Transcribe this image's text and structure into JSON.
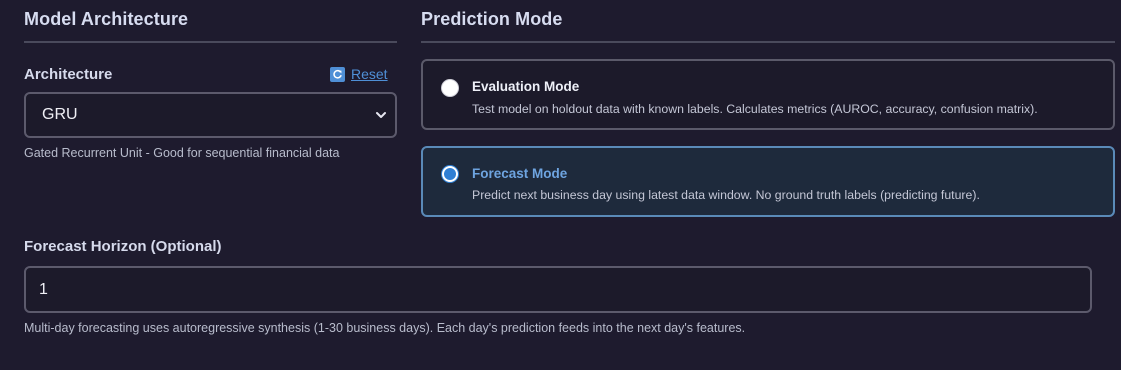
{
  "model_architecture": {
    "title": "Model Architecture",
    "architecture_label": "Architecture",
    "reset_label": "Reset",
    "reset_icon": "refresh-icon",
    "selected_value": "GRU",
    "help_text": "Gated Recurrent Unit - Good for sequential financial data"
  },
  "prediction_mode": {
    "title": "Prediction Mode",
    "options": [
      {
        "label": "Evaluation Mode",
        "description": "Test model on holdout data with known labels. Calculates metrics (AUROC, accuracy, confusion matrix).",
        "selected": false
      },
      {
        "label": "Forecast Mode",
        "description": "Predict next business day using latest data window. No ground truth labels (predicting future).",
        "selected": true
      }
    ]
  },
  "forecast_horizon": {
    "label": "Forecast Horizon (Optional)",
    "value": "1",
    "help_text": "Multi-day forecasting uses autoregressive synthesis (1-30 business days). Each day's prediction feeds into the next day's features."
  },
  "colors": {
    "background": "#1e1b2e",
    "accent": "#2f7fd4",
    "link": "#4f8fd6",
    "selected_border": "#5a8ab8"
  }
}
